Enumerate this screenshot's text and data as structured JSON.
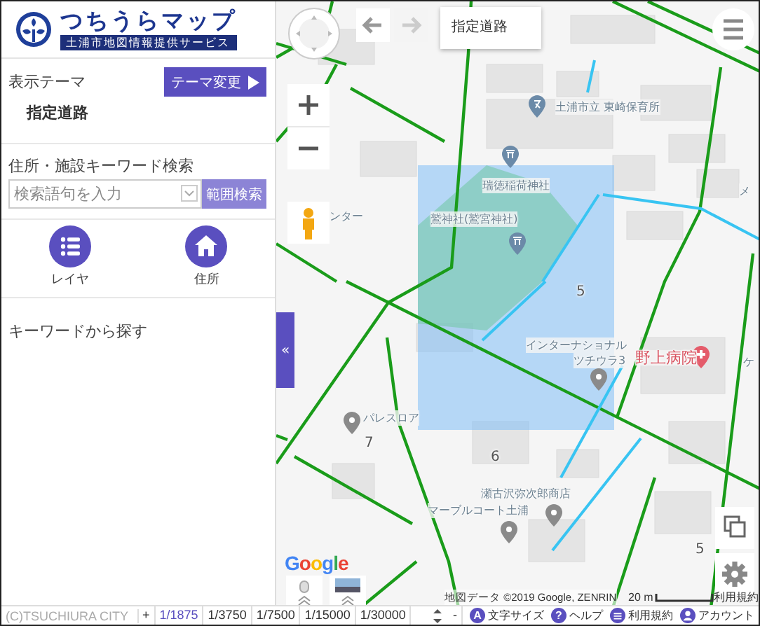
{
  "logo": {
    "title": "つちうらマップ",
    "subtitle": "土浦市地図情報提供サービス"
  },
  "sidebar": {
    "theme_label": "表示テーマ",
    "theme_button": "テーマ変更",
    "theme_value": "指定道路",
    "search_label": "住所・施設キーワード検索",
    "search": {
      "placeholder": "検索語句を入力"
    },
    "range_button": "範囲検索",
    "shortcuts": [
      {
        "kind": "layers",
        "label": "レイヤ"
      },
      {
        "kind": "address",
        "label": "住所"
      }
    ],
    "keyword_heading": "キーワードから探す",
    "collapse": "«"
  },
  "map": {
    "theme_chip": "指定道路",
    "labels": [
      {
        "kind": "place",
        "text": "土浦市立 東崎保育所"
      },
      {
        "kind": "place",
        "text": "瑞徳稲荷神社"
      },
      {
        "kind": "place",
        "text": "メ"
      },
      {
        "kind": "place",
        "text": "ンター"
      },
      {
        "kind": "place",
        "text": "鷲神社(鷲宮神社)"
      },
      {
        "kind": "number",
        "text": "5"
      },
      {
        "kind": "place",
        "text": "インターナショナル"
      },
      {
        "kind": "place",
        "text": "ツチウラ3"
      },
      {
        "kind": "medical",
        "text": "野上病院"
      },
      {
        "kind": "place",
        "text": "ケ"
      },
      {
        "kind": "place",
        "text": "パレスロア"
      },
      {
        "kind": "number",
        "text": "7"
      },
      {
        "kind": "number",
        "text": "6"
      },
      {
        "kind": "place",
        "text": "瀬古沢弥次郎商店"
      },
      {
        "kind": "place",
        "text": "マーブルコート土浦"
      },
      {
        "kind": "number",
        "text": "5"
      }
    ],
    "google_logo": "Google",
    "attribution": "地図データ ©2019 Google, ZENRIN",
    "scale": "20 m",
    "terms": "利用規約"
  },
  "status_bar": {
    "copyright": "(C)TSUCHIURA CITY",
    "zoom_in": "+",
    "zoom_out": "-",
    "scales": [
      {
        "label": "1/1875",
        "selected": true
      },
      {
        "label": "1/3750",
        "selected": false
      },
      {
        "label": "1/7500",
        "selected": false
      },
      {
        "label": "1/15000",
        "selected": false
      },
      {
        "label": "1/30000",
        "selected": false
      }
    ],
    "links": [
      {
        "kind": "font",
        "icon": "A",
        "label": "文字サイズ"
      },
      {
        "kind": "help",
        "icon": "?",
        "label": "ヘルプ"
      },
      {
        "kind": "terms",
        "label": "利用規約"
      },
      {
        "kind": "account",
        "label": "アカウント"
      }
    ]
  }
}
